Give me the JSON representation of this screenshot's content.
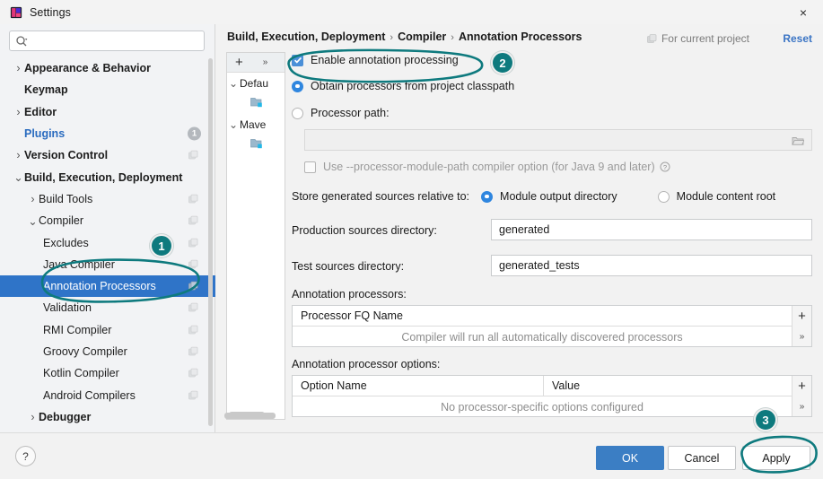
{
  "window": {
    "title": "Settings",
    "app_icon": "intellij-idea-icon",
    "close_label": "×"
  },
  "sidebar": {
    "search": {
      "placeholder": "",
      "value": "",
      "icon": "search-icon"
    },
    "items": [
      {
        "label": "Appearance & Behavior",
        "arrow": "›",
        "indent": 14,
        "bold": true,
        "scope_icon": false
      },
      {
        "label": "Keymap",
        "arrow": "",
        "indent": 27,
        "bold": true,
        "scope_icon": false
      },
      {
        "label": "Editor",
        "arrow": "›",
        "indent": 14,
        "bold": true,
        "scope_icon": false
      },
      {
        "label": "Plugins",
        "arrow": "",
        "indent": 27,
        "bold": true,
        "link": true,
        "badge": "1"
      },
      {
        "label": "Version Control",
        "arrow": "›",
        "indent": 14,
        "bold": true,
        "scope_icon": true
      },
      {
        "label": "Build, Execution, Deployment",
        "arrow": "⌄",
        "indent": 14,
        "bold": true,
        "scope_icon": false
      },
      {
        "label": "Build Tools",
        "arrow": "›",
        "indent": 30,
        "bold": false,
        "scope_icon": true
      },
      {
        "label": "Compiler",
        "arrow": "⌄",
        "indent": 30,
        "bold": false,
        "scope_icon": true
      },
      {
        "label": "Excludes",
        "arrow": "",
        "indent": 48,
        "bold": false,
        "scope_icon": true
      },
      {
        "label": "Java Compiler",
        "arrow": "",
        "indent": 48,
        "bold": false,
        "scope_icon": true
      },
      {
        "label": "Annotation Processors",
        "arrow": "",
        "indent": 48,
        "bold": false,
        "scope_icon": true,
        "selected": true
      },
      {
        "label": "Validation",
        "arrow": "",
        "indent": 48,
        "bold": false,
        "scope_icon": true
      },
      {
        "label": "RMI Compiler",
        "arrow": "",
        "indent": 48,
        "bold": false,
        "scope_icon": true
      },
      {
        "label": "Groovy Compiler",
        "arrow": "",
        "indent": 48,
        "bold": false,
        "scope_icon": true
      },
      {
        "label": "Kotlin Compiler",
        "arrow": "",
        "indent": 48,
        "bold": false,
        "scope_icon": true
      },
      {
        "label": "Android Compilers",
        "arrow": "",
        "indent": 48,
        "bold": false,
        "scope_icon": true
      },
      {
        "label": "Debugger",
        "arrow": "›",
        "indent": 30,
        "bold": true,
        "scope_icon": false
      }
    ]
  },
  "header": {
    "breadcrumb": [
      "Build, Execution, Deployment",
      "Compiler",
      "Annotation Processors"
    ],
    "separator": "›",
    "for_current_project": "For current project",
    "reset": "Reset"
  },
  "module_panel": {
    "add_label": "+",
    "more_label": "»",
    "rows": [
      {
        "label": "Defau",
        "arrow": "⌄",
        "type": "group"
      },
      {
        "label": "",
        "arrow": "",
        "type": "folder"
      },
      {
        "label": "Mave",
        "arrow": "⌄",
        "type": "group"
      },
      {
        "label": "",
        "arrow": "",
        "type": "folder"
      }
    ]
  },
  "main": {
    "enable_annotation_processing": {
      "label": "Enable annotation processing",
      "checked": true
    },
    "processor_source": {
      "selected": "obtain_classpath",
      "options": [
        {
          "id": "obtain_classpath",
          "label": "Obtain processors from project classpath"
        },
        {
          "id": "processor_path",
          "label": "Processor path:"
        }
      ]
    },
    "processor_path_field": {
      "value": "",
      "enabled": false,
      "browse_icon": "folder-icon"
    },
    "module_path_option": {
      "label": "Use --processor-module-path compiler option (for Java 9 and later)",
      "checked": false,
      "help_icon": "help-icon"
    },
    "store_relative_to": {
      "label": "Store generated sources relative to:",
      "selected": "module_output",
      "options": [
        {
          "id": "module_output",
          "label": "Module output directory"
        },
        {
          "id": "module_content_root",
          "label": "Module content root"
        }
      ]
    },
    "production_sources": {
      "label": "Production sources directory:",
      "value": "generated"
    },
    "test_sources": {
      "label": "Test sources directory:",
      "value": "generated_tests"
    },
    "annotation_processors": {
      "label": "Annotation processors:",
      "columns": [
        "Processor FQ Name"
      ],
      "empty_text": "Compiler will run all automatically discovered processors",
      "add_label": "+",
      "more_label": "»"
    },
    "annotation_processor_options": {
      "label": "Annotation processor options:",
      "columns": [
        "Option Name",
        "Value"
      ],
      "empty_text": "No processor-specific options configured",
      "add_label": "+",
      "more_label": "»"
    }
  },
  "footer": {
    "help_label": "?",
    "ok": "OK",
    "cancel": "Cancel",
    "apply": "Apply"
  },
  "annotations": {
    "color": "#0e7a7e",
    "markers": [
      {
        "number": "1",
        "target": "sidebar-item-annotation-processors"
      },
      {
        "number": "2",
        "target": "enable-annotation-processing-checkbox"
      },
      {
        "number": "3",
        "target": "apply-button"
      }
    ]
  }
}
